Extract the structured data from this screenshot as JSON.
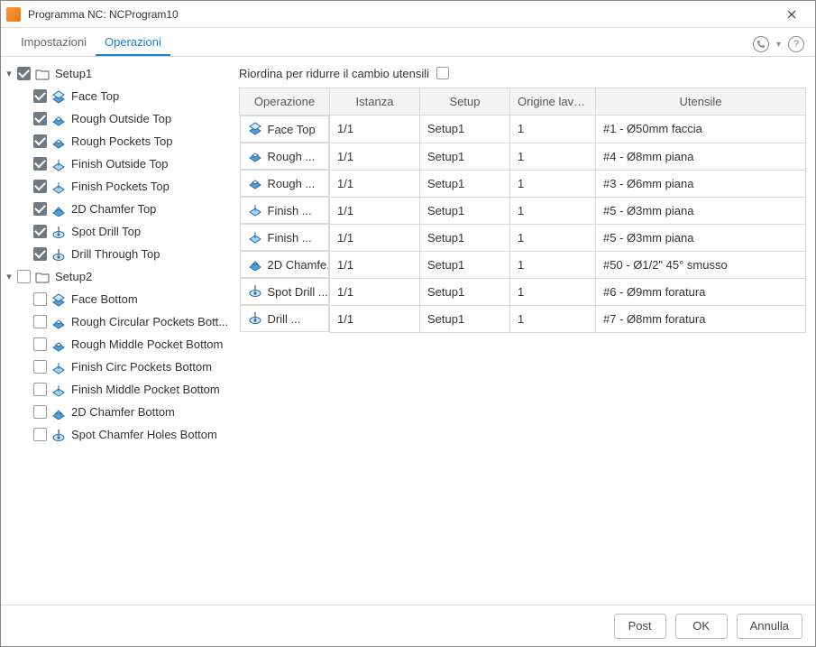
{
  "window": {
    "title": "Programma NC: NCProgram10"
  },
  "tabs": {
    "settings": "Impostazioni",
    "operations": "Operazioni"
  },
  "reorder_label": "Riordina per ridurre il cambio utensili",
  "tree": [
    {
      "type": "setup",
      "label": "Setup1",
      "checked": true,
      "expanded": true,
      "children": [
        {
          "label": "Face Top",
          "checked": true,
          "icon": "face"
        },
        {
          "label": "Rough Outside Top",
          "checked": true,
          "icon": "rough"
        },
        {
          "label": "Rough Pockets Top",
          "checked": true,
          "icon": "rough"
        },
        {
          "label": "Finish Outside Top",
          "checked": true,
          "icon": "finish"
        },
        {
          "label": "Finish Pockets Top",
          "checked": true,
          "icon": "finish"
        },
        {
          "label": "2D Chamfer Top",
          "checked": true,
          "icon": "chamfer"
        },
        {
          "label": "Spot Drill Top",
          "checked": true,
          "icon": "drill"
        },
        {
          "label": "Drill Through Top",
          "checked": true,
          "icon": "drill"
        }
      ]
    },
    {
      "type": "setup",
      "label": "Setup2",
      "checked": false,
      "expanded": true,
      "children": [
        {
          "label": "Face Bottom",
          "checked": false,
          "icon": "face"
        },
        {
          "label": "Rough Circular Pockets Bott...",
          "checked": false,
          "icon": "rough"
        },
        {
          "label": "Rough Middle Pocket Bottom",
          "checked": false,
          "icon": "rough"
        },
        {
          "label": "Finish Circ Pockets Bottom",
          "checked": false,
          "icon": "finish"
        },
        {
          "label": "Finish Middle Pocket Bottom",
          "checked": false,
          "icon": "finish"
        },
        {
          "label": "2D Chamfer Bottom",
          "checked": false,
          "icon": "chamfer"
        },
        {
          "label": "Spot Chamfer Holes Bottom",
          "checked": false,
          "icon": "drill"
        }
      ]
    }
  ],
  "table": {
    "headers": {
      "op": "Operazione",
      "ist": "Istanza",
      "setup": "Setup",
      "orig": "Origine lavoro",
      "tool": "Utensile"
    },
    "rows": [
      {
        "icon": "face",
        "op": "Face Top",
        "ist": "1/1",
        "setup": "Setup1",
        "orig": "1",
        "tool": "#1 - Ø50mm faccia"
      },
      {
        "icon": "rough",
        "op": "Rough ...",
        "ist": "1/1",
        "setup": "Setup1",
        "orig": "1",
        "tool": "#4 - Ø8mm piana"
      },
      {
        "icon": "rough",
        "op": "Rough ...",
        "ist": "1/1",
        "setup": "Setup1",
        "orig": "1",
        "tool": "#3 - Ø6mm piana"
      },
      {
        "icon": "finish",
        "op": "Finish ...",
        "ist": "1/1",
        "setup": "Setup1",
        "orig": "1",
        "tool": "#5 - Ø3mm piana"
      },
      {
        "icon": "finish",
        "op": "Finish ...",
        "ist": "1/1",
        "setup": "Setup1",
        "orig": "1",
        "tool": "#5 - Ø3mm piana"
      },
      {
        "icon": "chamfer",
        "op": "2D Chamfe...",
        "ist": "1/1",
        "setup": "Setup1",
        "orig": "1",
        "tool": "#50 - Ø1/2\" 45° smusso"
      },
      {
        "icon": "drill",
        "op": "Spot Drill ...",
        "ist": "1/1",
        "setup": "Setup1",
        "orig": "1",
        "tool": "#6 - Ø9mm foratura"
      },
      {
        "icon": "drill",
        "op": "Drill ...",
        "ist": "1/1",
        "setup": "Setup1",
        "orig": "1",
        "tool": "#7 - Ø8mm foratura"
      }
    ]
  },
  "buttons": {
    "post": "Post",
    "ok": "OK",
    "cancel": "Annulla"
  }
}
